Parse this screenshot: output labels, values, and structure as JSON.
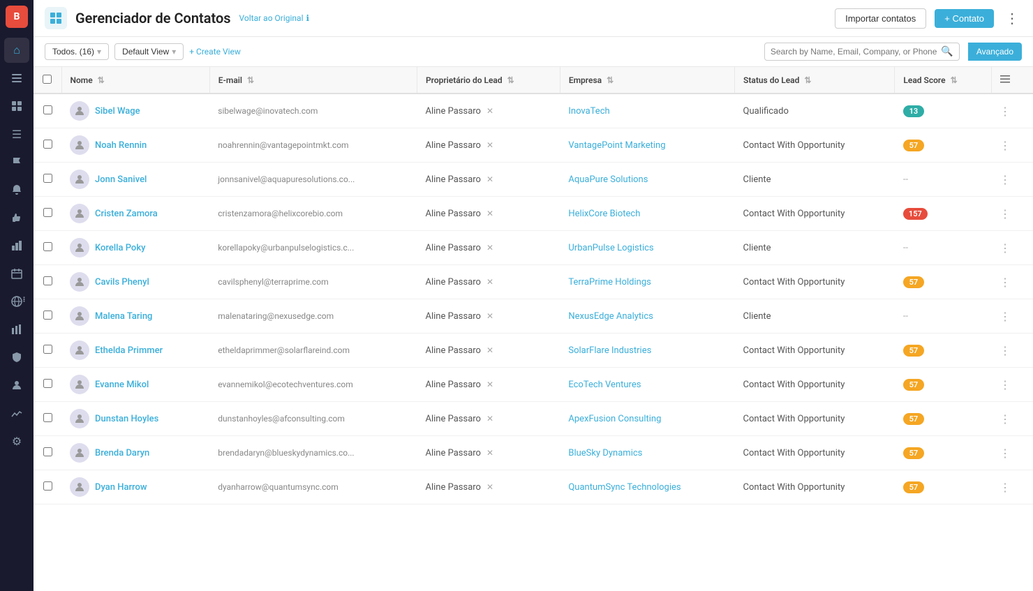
{
  "sidebar": {
    "logo": "B",
    "icons": [
      {
        "name": "home-icon",
        "symbol": "⌂"
      },
      {
        "name": "users-icon",
        "symbol": "👤"
      },
      {
        "name": "grid-icon",
        "symbol": "⊞"
      },
      {
        "name": "list-icon",
        "symbol": "☰"
      },
      {
        "name": "flag-icon",
        "symbol": "⚑"
      },
      {
        "name": "bell-icon",
        "symbol": "🔔"
      },
      {
        "name": "thumbup-icon",
        "symbol": "👍"
      },
      {
        "name": "chart-icon",
        "symbol": "📊"
      },
      {
        "name": "calendar-icon",
        "symbol": "📅"
      },
      {
        "name": "globe-icon",
        "symbol": "🌐"
      },
      {
        "name": "barchart-icon",
        "symbol": "📈"
      },
      {
        "name": "shield-icon",
        "symbol": "🛡"
      },
      {
        "name": "person-icon",
        "symbol": "👤"
      },
      {
        "name": "stats-icon",
        "symbol": "📉"
      },
      {
        "name": "settings-icon",
        "symbol": "⚙"
      }
    ]
  },
  "header": {
    "title": "Gerenciador de Contatos",
    "back_link": "Voltar ao Original",
    "info_icon": "ℹ",
    "import_label": "Importar contatos",
    "add_label": "+ Contato",
    "more_icon": "⋮"
  },
  "toolbar": {
    "filter_all": "Todos. (16)",
    "filter_view": "Default View",
    "create_view": "+ Create View",
    "search_placeholder": "Search by Name, Email, Company, or Phone",
    "advanced_label": "Avançado"
  },
  "table": {
    "columns": [
      {
        "key": "checkbox",
        "label": ""
      },
      {
        "key": "name",
        "label": "Nome"
      },
      {
        "key": "email",
        "label": "E-mail"
      },
      {
        "key": "lead_owner",
        "label": "Proprietário do Lead"
      },
      {
        "key": "company",
        "label": "Empresa"
      },
      {
        "key": "lead_status",
        "label": "Status do Lead"
      },
      {
        "key": "lead_score",
        "label": "Lead Score"
      },
      {
        "key": "actions",
        "label": ""
      }
    ],
    "rows": [
      {
        "name": "Sibel Wage",
        "email": "sibelwage@inovatech.com",
        "lead_owner": "Aline Passaro",
        "company": "InovaTech",
        "lead_status": "Qualificado",
        "lead_score": "13",
        "score_color": "teal"
      },
      {
        "name": "Noah Rennin",
        "email": "noahrennin@vantagepointmkt.com",
        "lead_owner": "Aline Passaro",
        "company": "VantagePoint Marketing",
        "lead_status": "Contact With Opportunity",
        "lead_score": "57",
        "score_color": "orange"
      },
      {
        "name": "Jonn Sanivel",
        "email": "jonnsanivel@aquapuresolutions.co...",
        "lead_owner": "Aline Passaro",
        "company": "AquaPure Solutions",
        "lead_status": "Cliente",
        "lead_score": "--",
        "score_color": "dash"
      },
      {
        "name": "Cristen Zamora",
        "email": "cristenzamora@helixcorebio.com",
        "lead_owner": "Aline Passaro",
        "company": "HelixCore Biotech",
        "lead_status": "Contact With Opportunity",
        "lead_score": "157",
        "score_color": "red"
      },
      {
        "name": "Korella Poky",
        "email": "korellapoky@urbanpulselogistics.c...",
        "lead_owner": "Aline Passaro",
        "company": "UrbanPulse Logistics",
        "lead_status": "Cliente",
        "lead_score": "--",
        "score_color": "dash"
      },
      {
        "name": "Cavils Phenyl",
        "email": "cavilsphenyl@terraprime.com",
        "lead_owner": "Aline Passaro",
        "company": "TerraPrime Holdings",
        "lead_status": "Contact With Opportunity",
        "lead_score": "57",
        "score_color": "orange"
      },
      {
        "name": "Malena Taring",
        "email": "malenataring@nexusedge.com",
        "lead_owner": "Aline Passaro",
        "company": "NexusEdge Analytics",
        "lead_status": "Cliente",
        "lead_score": "--",
        "score_color": "dash"
      },
      {
        "name": "Ethelda Primmer",
        "email": "etheldaprimmer@solarflareind.com",
        "lead_owner": "Aline Passaro",
        "company": "SolarFlare Industries",
        "lead_status": "Contact With Opportunity",
        "lead_score": "57",
        "score_color": "orange"
      },
      {
        "name": "Evanne Mikol",
        "email": "evannemikol@ecotechventures.com",
        "lead_owner": "Aline Passaro",
        "company": "EcoTech Ventures",
        "lead_status": "Contact With Opportunity",
        "lead_score": "57",
        "score_color": "orange"
      },
      {
        "name": "Dunstan Hoyles",
        "email": "dunstanhoyles@afconsulting.com",
        "lead_owner": "Aline Passaro",
        "company": "ApexFusion Consulting",
        "lead_status": "Contact With Opportunity",
        "lead_score": "57",
        "score_color": "orange"
      },
      {
        "name": "Brenda Daryn",
        "email": "brendadaryn@blueskydynamics.co...",
        "lead_owner": "Aline Passaro",
        "company": "BlueSky Dynamics",
        "lead_status": "Contact With Opportunity",
        "lead_score": "57",
        "score_color": "orange"
      },
      {
        "name": "Dyan Harrow",
        "email": "dyanharrow@quantumsync.com",
        "lead_owner": "Aline Passaro",
        "company": "QuantumSync Technologies",
        "lead_status": "Contact With Opportunity",
        "lead_score": "57",
        "score_color": "orange"
      }
    ]
  }
}
